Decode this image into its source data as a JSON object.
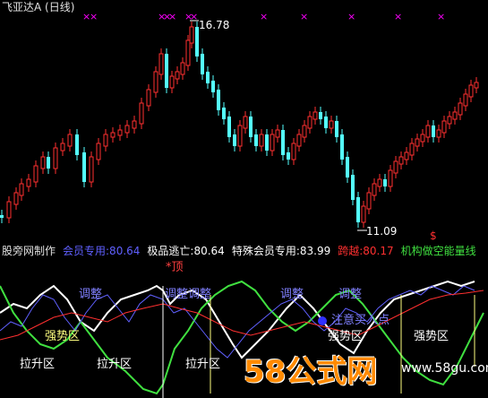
{
  "window": {
    "title": "飞亚达A (日线)"
  },
  "price_chart": {
    "high_label": "16.78",
    "low_label": "11.09",
    "marker_symbol": "×",
    "dollar_marker": "$",
    "colors": {
      "up": "#ff3030",
      "down": "#54ffff",
      "marker": "#ff00ff",
      "label": "#ffffff"
    }
  },
  "indicator_bar": {
    "source": "股旁网制作",
    "member": "会员专用:80.64",
    "escape": "极品逃亡:80.64",
    "special": "特殊会员专用:83.99",
    "cross": "跨越:80.17",
    "inst": "机构做空能量线"
  },
  "indicator_chart": {
    "labels": {
      "top": "*顶",
      "adjust_1": "调整",
      "adjust_2": "调整调整",
      "adjust_3": "调整",
      "adjust_4": "调整",
      "strong_1": "强势区",
      "strong_2": "强势区",
      "strong_3": "强势区",
      "pull_1": "拉升区",
      "pull_2": "拉升区",
      "pull_3": "拉升区",
      "buy": "注意买入点"
    },
    "colors": {
      "white": "#ffffff",
      "green": "#40e040",
      "blue": "#6060ff",
      "red": "#ff3030",
      "yellow": "#ffff80"
    }
  },
  "watermark": {
    "main": "58公式网",
    "url": "www.58gu.com"
  }
}
